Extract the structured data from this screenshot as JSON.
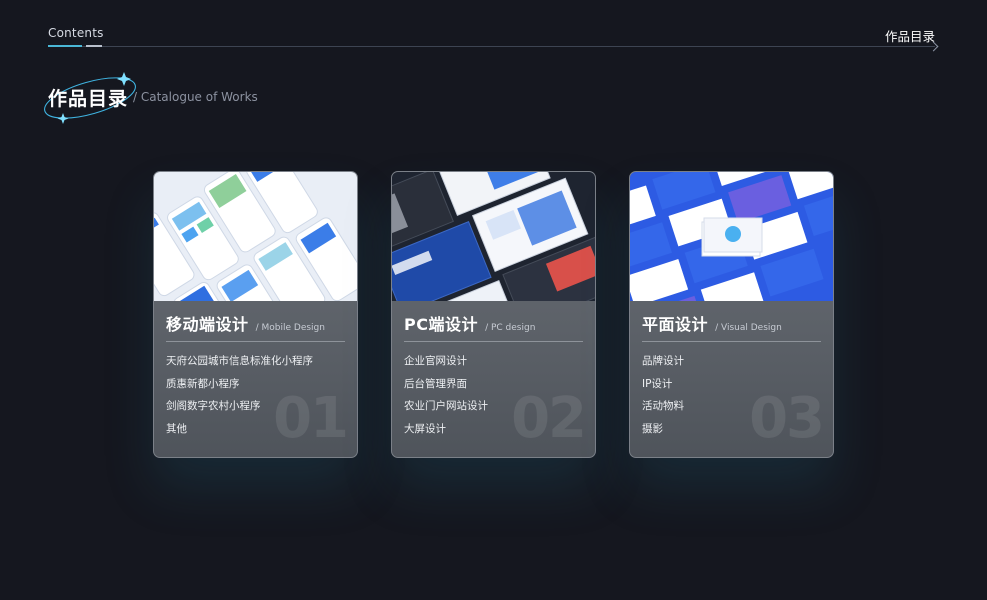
{
  "header": {
    "left_label": "Contents",
    "right_label": "作品目录"
  },
  "heading": {
    "title_cn": "作品目录",
    "title_en": "/ Catalogue of Works"
  },
  "cards": [
    {
      "title": "移动端设计",
      "subtitle": "/ Mobile Design",
      "items": [
        "天府公园城市信息标准化小程序",
        "质惠新都小程序",
        "剑阁数字农村小程序",
        "其他"
      ],
      "number": "01"
    },
    {
      "title": "PC端设计",
      "subtitle": "/ PC design",
      "items": [
        "企业官网设计",
        "后台管理界面",
        "农业门户网站设计",
        "大屏设计"
      ],
      "number": "02"
    },
    {
      "title": "平面设计",
      "subtitle": "/ Visual Design",
      "items": [
        "品牌设计",
        "IP设计",
        "活动物料",
        "摄影"
      ],
      "number": "03"
    }
  ],
  "colors": {
    "background": "#15171f",
    "accent": "#4ab7d6",
    "brand_blue": "#2d5be3"
  }
}
